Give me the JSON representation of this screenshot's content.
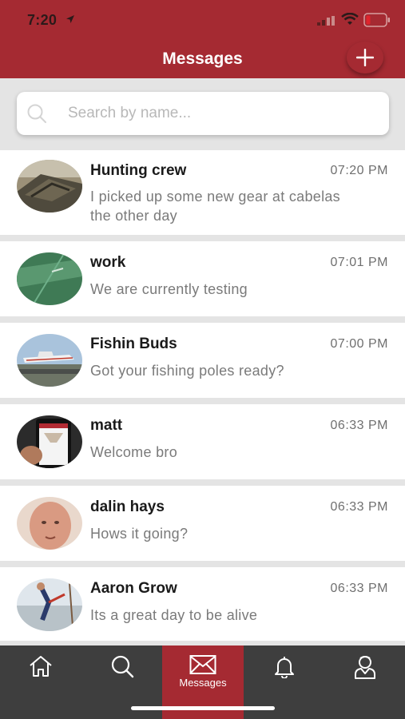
{
  "status_bar": {
    "time": "7:20"
  },
  "header": {
    "title": "Messages"
  },
  "search": {
    "placeholder": "Search by name..."
  },
  "conversations": [
    {
      "name": "Hunting crew",
      "time": "07:20 PM",
      "preview": "I picked up some new gear at cabelas the other day"
    },
    {
      "name": "work",
      "time": "07:01 PM",
      "preview": "We are currently testing"
    },
    {
      "name": "Fishin Buds",
      "time": "07:00 PM",
      "preview": "Got your fishing poles ready?"
    },
    {
      "name": "matt",
      "time": "06:33 PM",
      "preview": "Welcome bro"
    },
    {
      "name": "dalin hays",
      "time": "06:33 PM",
      "preview": "Hows it going?"
    },
    {
      "name": "Aaron Grow",
      "time": "06:33 PM",
      "preview": "Its a great day to be alive"
    }
  ],
  "tabbar": {
    "items": [
      {
        "icon": "home-icon"
      },
      {
        "icon": "search-icon"
      },
      {
        "icon": "envelope-icon",
        "label": "Messages",
        "active": true
      },
      {
        "icon": "bell-icon"
      },
      {
        "icon": "profile-icon"
      }
    ]
  },
  "colors": {
    "brand": "#a52a32",
    "tabbar": "#3e3e3e",
    "background": "#e4e4e4"
  }
}
